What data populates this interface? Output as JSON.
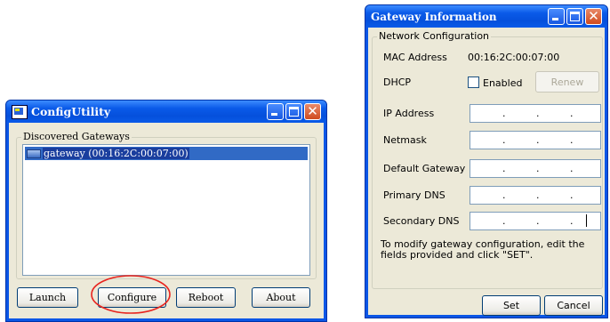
{
  "config_utility": {
    "title": "ConfigUtility",
    "group_label": "Discovered Gateways",
    "gateways": [
      {
        "label": "gateway (00:16:2C:00:07:00)"
      }
    ],
    "buttons": {
      "launch": "Launch",
      "configure": "Configure",
      "reboot": "Reboot",
      "about": "About"
    }
  },
  "gateway_info": {
    "title": "Gateway Information",
    "group_label": "Network Configuration",
    "mac_label": "MAC Address",
    "mac_value": "00:16:2C:00:07:00",
    "dhcp_label": "DHCP",
    "dhcp_checkbox_label": "Enabled",
    "dhcp_checked": false,
    "renew_label": "Renew",
    "fields": [
      {
        "label": "IP Address"
      },
      {
        "label": "Netmask"
      },
      {
        "label": "Default Gateway"
      },
      {
        "label": "Primary DNS"
      },
      {
        "label": "Secondary DNS"
      }
    ],
    "instructions": "To modify gateway configuration, edit the fields provided and click \"SET\".",
    "buttons": {
      "set": "Set",
      "cancel": "Cancel"
    }
  },
  "colors": {
    "titlebar": "#0a56e6",
    "window_face": "#ece9d8",
    "selection": "#316ac5",
    "highlight_circle": "#e8231e"
  }
}
